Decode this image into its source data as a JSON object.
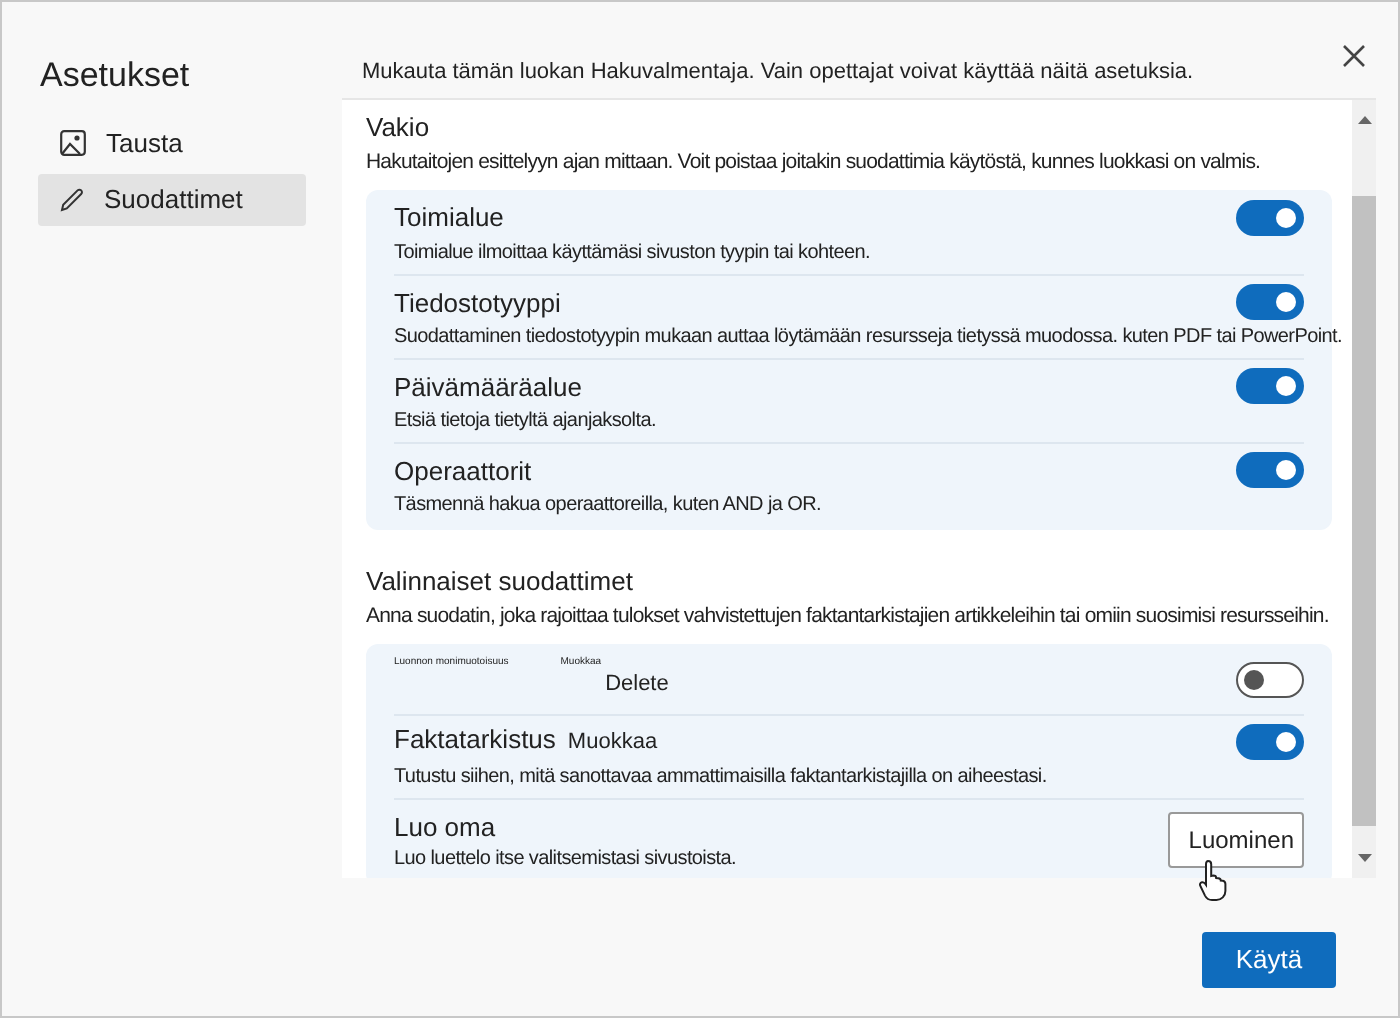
{
  "sidebar": {
    "title": "Asetukset",
    "items": [
      {
        "label": "Tausta",
        "selected": false
      },
      {
        "label": "Suodattimet",
        "selected": true
      }
    ]
  },
  "intro": "Mukauta tämän luokan Hakuvalmentaja. Vain opettajat voivat käyttää näitä asetuksia.",
  "sections": [
    {
      "title": "Vakio",
      "description": "Hakutaitojen esittelyyn ajan mittaan. Voit poistaa joitakin suodattimia käytöstä, kunnes luokkasi on valmis.",
      "items": [
        {
          "kind": "toggle",
          "title": "Toimialue",
          "description": "Toimialue ilmoittaa käyttämäsi sivuston tyypin tai kohteen.",
          "on": true
        },
        {
          "kind": "toggle",
          "title": "Tiedostotyyppi",
          "description": "Suodattaminen tiedostotyypin mukaan auttaa löytämään resursseja tietyssä muodossa. kuten PDF tai PowerPoint.",
          "on": true
        },
        {
          "kind": "toggle",
          "title": "Päivämääräalue",
          "description": "Etsiä tietoja tietyltä ajanjaksolta.",
          "on": true
        },
        {
          "kind": "toggle",
          "title": "Operaattorit",
          "description": "Täsmennä hakua operaattoreilla, kuten AND ja OR.",
          "on": true
        }
      ]
    },
    {
      "title": "Valinnaiset suodattimet",
      "description": "Anna suodatin, joka rajoittaa tulokset vahvistettujen faktantarkistajien artikkeleihin tai omiin suosimisi resursseihin.",
      "items": [
        {
          "kind": "custom",
          "title": "Luonnon monimuotoisuus",
          "edit": "Muokkaa",
          "delete": "Delete",
          "on": false
        },
        {
          "kind": "toggle",
          "title": "Faktatarkistus",
          "edit": "Muokkaa",
          "description": "Tutustu siihen, mitä sanottavaa ammattimaisilla faktantarkistajilla on aiheestasi.",
          "on": true
        },
        {
          "kind": "button",
          "title": "Luo oma",
          "description": "Luo luettelo itse valitsemistasi sivustoista.",
          "button": "Luominen"
        }
      ]
    }
  ],
  "apply": "Käytä"
}
